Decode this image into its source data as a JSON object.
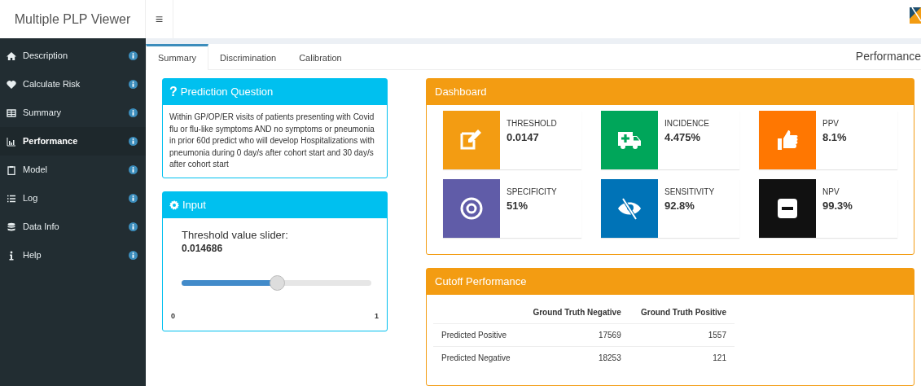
{
  "app": {
    "title": "Multiple PLP Viewer",
    "menu_toggle": "≡"
  },
  "sidebar": {
    "items": [
      {
        "label": "Description",
        "kind": "home",
        "selected": false
      },
      {
        "label": "Calculate Risk",
        "kind": "heart",
        "selected": false
      },
      {
        "label": "Summary",
        "kind": "table",
        "selected": false
      },
      {
        "label": "Performance",
        "kind": "chart",
        "selected": true
      },
      {
        "label": "Model",
        "kind": "clipboard",
        "selected": false
      },
      {
        "label": "Log",
        "kind": "list",
        "selected": false
      },
      {
        "label": "Data Info",
        "kind": "database",
        "selected": false
      },
      {
        "label": "Help",
        "kind": "info",
        "selected": false
      }
    ]
  },
  "tabs": [
    {
      "label": "Summary",
      "selected": true
    },
    {
      "label": "Discrimination",
      "selected": false
    },
    {
      "label": "Calibration",
      "selected": false
    }
  ],
  "page_title": "Performance",
  "prediction_question": {
    "icon_char": "?",
    "title": "Prediction Question",
    "text": "Within GP/OP/ER visits of patients presenting with Covid flu or flu-like symptoms AND no symptoms or pneumonia in prior 60d predict who will develop Hospitalizations with pneumonia during 0 day/s after cohort start and 30 day/s after cohort start"
  },
  "input": {
    "title": "Input",
    "slider": {
      "label": "Threshold value slider:",
      "value": "0.014686",
      "level": 0.5,
      "min": "0",
      "max": "1"
    }
  },
  "dashboard": {
    "title": "Dashboard",
    "tiles": [
      {
        "label": "THRESHOLD",
        "value": "0.0147",
        "kind": "edit",
        "color": "#f39c12"
      },
      {
        "label": "INCIDENCE",
        "value": "4.475%",
        "kind": "ambulance",
        "color": "#00a65a"
      },
      {
        "label": "PPV",
        "value": "8.1%",
        "kind": "thumb",
        "color": "#ff7701"
      },
      {
        "label": "SPECIFICITY",
        "value": "51%",
        "kind": "target",
        "color": "#605ca8"
      },
      {
        "label": "SENSITIVITY",
        "value": "92.8%",
        "kind": "eyeslash",
        "color": "#0073b7"
      },
      {
        "label": "NPV",
        "value": "99.3%",
        "kind": "minus",
        "color": "#111111"
      }
    ]
  },
  "cutoff": {
    "title": "Cutoff Performance",
    "columns": [
      "Ground Truth Negative",
      "Ground Truth Positive"
    ],
    "rows": [
      {
        "label": "Predicted Positive",
        "cells": [
          "17569",
          "1557"
        ]
      },
      {
        "label": "Predicted Negative",
        "cells": [
          "18253",
          "121"
        ]
      }
    ]
  }
}
